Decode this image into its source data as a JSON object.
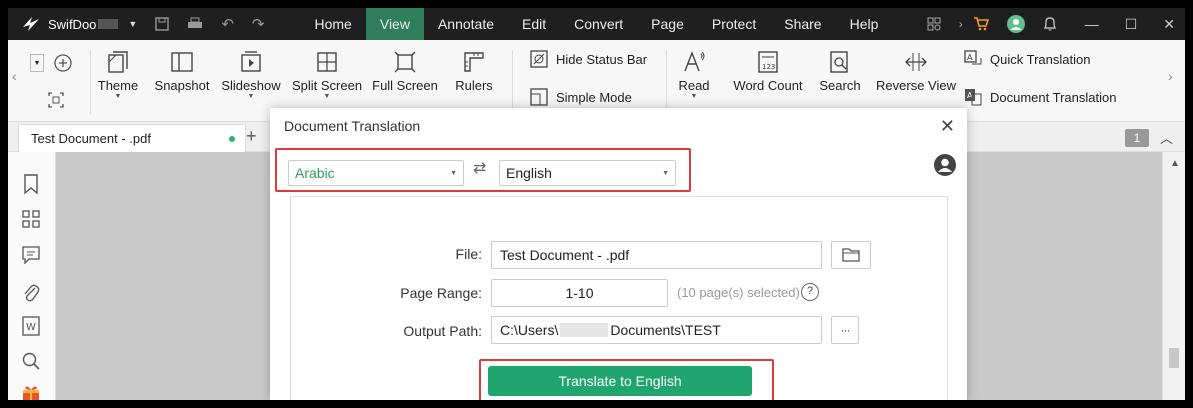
{
  "app": {
    "name": "SwifDoo"
  },
  "menubar": {
    "items": [
      "Home",
      "View",
      "Annotate",
      "Edit",
      "Convert",
      "Page",
      "Protect",
      "Share",
      "Help"
    ],
    "active": "View"
  },
  "ribbon": {
    "theme": "Theme",
    "snapshot": "Snapshot",
    "slideshow": "Slideshow",
    "split_screen": "Split Screen",
    "full_screen": "Full Screen",
    "rulers": "Rulers",
    "hide_status_bar": "Hide Status Bar",
    "simple_mode": "Simple Mode",
    "read": "Read",
    "word_count": "Word Count",
    "search": "Search",
    "reverse_view": "Reverse View",
    "quick_translation": "Quick Translation",
    "document_translation": "Document Translation"
  },
  "tabs": {
    "doc_title": "Test Document - .pdf",
    "page_badge": "1"
  },
  "dialog": {
    "title": "Document Translation",
    "source_language": "Arabic",
    "target_language": "English",
    "file_label": "File:",
    "file_value": "Test Document - .pdf",
    "page_range_label": "Page Range:",
    "page_range_value": "1-10",
    "page_hint": "(10 page(s) selected)",
    "output_label": "Output Path:",
    "output_prefix": "C:\\Users\\",
    "output_suffix": "Documents\\TEST",
    "browse_more": "···",
    "translate_button": "Translate to English"
  },
  "colors": {
    "accent": "#2e7d5b",
    "primary": "#1fa56d",
    "highlight": "#e03a3a",
    "source_lang": "#2e9e5f"
  }
}
